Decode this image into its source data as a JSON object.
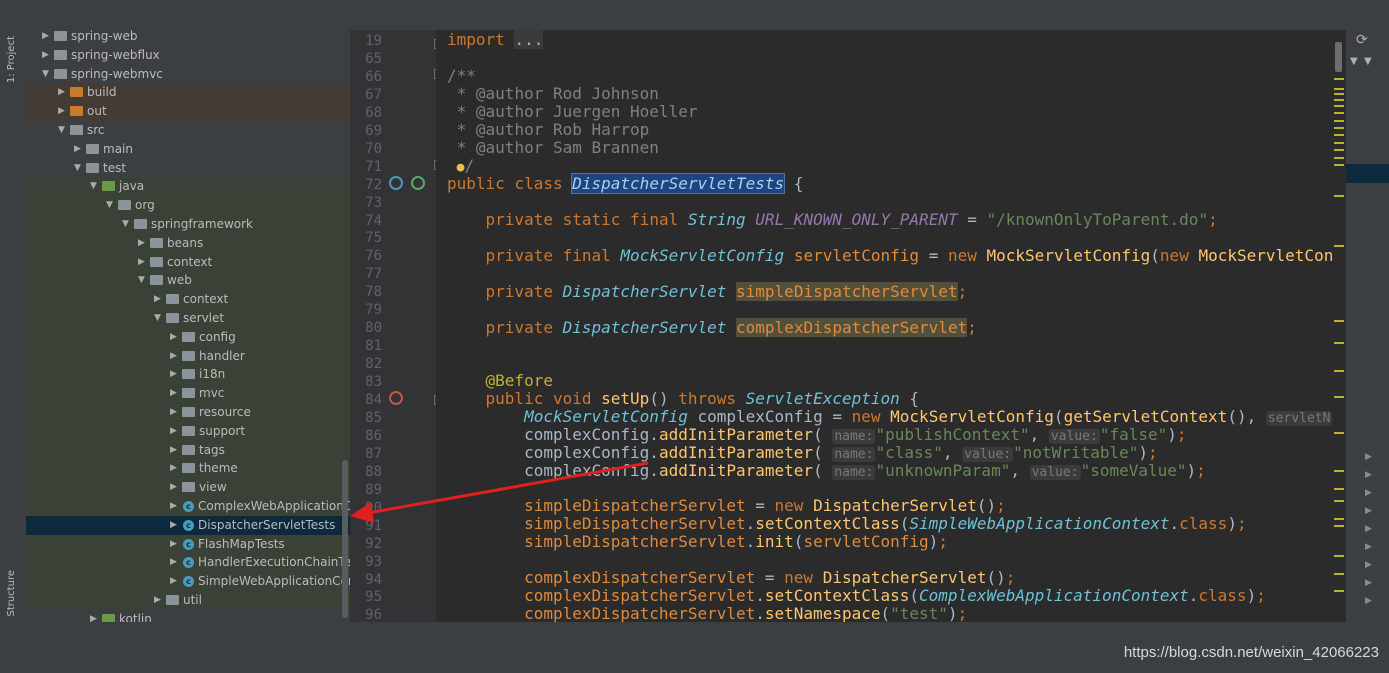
{
  "sidebar": {
    "project_label": "1: Project",
    "structure_label": "Structure"
  },
  "tree": [
    {
      "label": "spring-web",
      "icon": "module-folder-icon",
      "expanded": false
    },
    {
      "label": "spring-webflux",
      "icon": "module-folder-icon",
      "expanded": false
    },
    {
      "label": "spring-webmvc",
      "icon": "module-folder-icon",
      "expanded": true
    },
    {
      "label": "build",
      "icon": "excluded-folder-icon",
      "expanded": false
    },
    {
      "label": "out",
      "icon": "excluded-folder-icon",
      "expanded": false
    },
    {
      "label": "src",
      "icon": "folder-icon",
      "expanded": true
    },
    {
      "label": "main",
      "icon": "folder-icon",
      "expanded": false
    },
    {
      "label": "test",
      "icon": "folder-icon",
      "expanded": true
    },
    {
      "label": "java",
      "icon": "test-root-folder-icon",
      "expanded": true
    },
    {
      "label": "org",
      "icon": "package-icon",
      "expanded": true
    },
    {
      "label": "springframework",
      "icon": "package-icon",
      "expanded": true
    },
    {
      "label": "beans",
      "icon": "package-icon",
      "expanded": false
    },
    {
      "label": "context",
      "icon": "package-icon",
      "expanded": false
    },
    {
      "label": "web",
      "icon": "package-icon",
      "expanded": true
    },
    {
      "label": "context",
      "icon": "package-icon",
      "expanded": false
    },
    {
      "label": "servlet",
      "icon": "package-icon",
      "expanded": true
    },
    {
      "label": "config",
      "icon": "package-icon",
      "expanded": false
    },
    {
      "label": "handler",
      "icon": "package-icon",
      "expanded": false
    },
    {
      "label": "i18n",
      "icon": "package-icon",
      "expanded": false
    },
    {
      "label": "mvc",
      "icon": "package-icon",
      "expanded": false
    },
    {
      "label": "resource",
      "icon": "package-icon",
      "expanded": false
    },
    {
      "label": "support",
      "icon": "package-icon",
      "expanded": false
    },
    {
      "label": "tags",
      "icon": "package-icon",
      "expanded": false
    },
    {
      "label": "theme",
      "icon": "package-icon",
      "expanded": false
    },
    {
      "label": "view",
      "icon": "package-icon",
      "expanded": false
    },
    {
      "label": "ComplexWebApplicationCon",
      "icon": "java-class-icon",
      "expanded": false
    },
    {
      "label": "DispatcherServletTests",
      "icon": "java-class-icon",
      "expanded": false,
      "selected": true
    },
    {
      "label": "FlashMapTests",
      "icon": "java-class-icon",
      "expanded": false
    },
    {
      "label": "HandlerExecutionChainTests",
      "icon": "java-class-icon",
      "expanded": false
    },
    {
      "label": "SimpleWebApplicationConte",
      "icon": "java-class-icon",
      "expanded": false
    },
    {
      "label": "util",
      "icon": "package-icon",
      "expanded": false
    },
    {
      "label": "kotlin",
      "icon": "test-root-folder-icon",
      "expanded": false
    }
  ],
  "editor": {
    "line_numbers": [
      "19",
      "65",
      "66",
      "67",
      "68",
      "69",
      "70",
      "71",
      "72",
      "73",
      "74",
      "75",
      "76",
      "77",
      "78",
      "79",
      "80",
      "81",
      "82",
      "83",
      "84",
      "85",
      "86",
      "87",
      "88",
      "89",
      "90",
      "91",
      "92",
      "93",
      "94",
      "95",
      "96"
    ],
    "code": {
      "import_kw": "import",
      "import_dots": "...",
      "doc_open": "/**",
      "doc_tag": "@author",
      "author1": " Rod Johnson",
      "author2": " Juergen Hoeller",
      "author3": " Rob Harrop",
      "author4": " Sam Brannen",
      "doc_close": "/",
      "public": "public",
      "class_kw": "class",
      "class_name": "DispatcherServletTests",
      "brace_open": " {",
      "private": "private",
      "static": "static",
      "final": "final",
      "String": "String",
      "url_const": "URL_KNOWN_ONLY_PARENT",
      "eq": " = ",
      "url_value": "\"/knownOnlyToParent.do\"",
      "semi": ";",
      "MockServletConfig": "MockServletConfig",
      "servletConfig": "servletConfig",
      "new": "new",
      "mock_ctor": "MockServletConfig",
      "line76_tail": "(",
      "line76_cut": "MockServletCon",
      "DispatcherServlet": "DispatcherServlet",
      "simpleDispatcherServlet": "simpleDispatcherServlet",
      "complexDispatcherServlet": "complexDispatcherServlet",
      "before_ann": "@Before",
      "void": "void",
      "setUp": "setUp",
      "parens": "()",
      "throws": "throws",
      "ServletException": "ServletException",
      "complexConfig": "complexConfig",
      "getServletContext": "getServletContext",
      "hint_servlet": "servletN",
      "addInitParameter": "addInitParameter",
      "hint_name": "name:",
      "hint_value": "value:",
      "p1_name": "\"publishContext\"",
      "p1_value": "\"false\"",
      "p2_name": "\"class\"",
      "p2_value": "\"notWritable\"",
      "p3_name": "\"unknownParam\"",
      "p3_value": "\"someValue\"",
      "setContextClass": "setContextClass",
      "SimpleWebApplicationContext": "SimpleWebApplicationContext",
      "ComplexWebApplicationContext": "ComplexWebApplicationContext",
      "class_literal": "class",
      "init": "init",
      "setNamespace": "setNamespace",
      "ns_value": "\"test\""
    }
  },
  "watermark": "https://blog.csdn.net/weixin_42066223",
  "colors": {
    "keyword": "#cc7832",
    "string": "#6a8759",
    "comment": "#808080",
    "constant": "#9876aa",
    "annotation": "#bbb529",
    "method": "#ffc66d",
    "selection": "#0d293e",
    "arrow": "#e02020"
  }
}
